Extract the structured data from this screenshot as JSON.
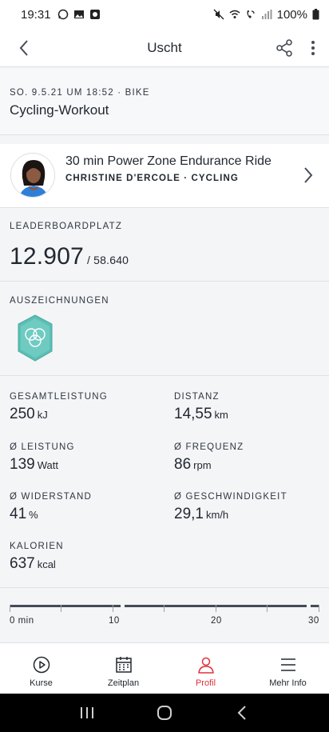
{
  "status_bar": {
    "time": "19:31",
    "battery": "100%"
  },
  "header": {
    "title": "Uscht"
  },
  "workout": {
    "meta": "SO. 9.5.21 UM 18:52 · BIKE",
    "name": "Cycling-Workout"
  },
  "class": {
    "title": "30 min Power Zone Endurance Ride",
    "subtitle": "CHRISTINE D'ERCOLE · CYCLING"
  },
  "leaderboard": {
    "label": "LEADERBOARDPLATZ",
    "rank": "12.907",
    "total": "/ 58.640"
  },
  "awards": {
    "label": "AUSZEICHNUNGEN",
    "badge_color": "#5bbfb5"
  },
  "stats": [
    {
      "label": "GESAMTLEISTUNG",
      "value": "250",
      "unit": "kJ"
    },
    {
      "label": "DISTANZ",
      "value": "14,55",
      "unit": "km"
    },
    {
      "label": "Ø LEISTUNG",
      "value": "139",
      "unit": "Watt"
    },
    {
      "label": "Ø FREQUENZ",
      "value": "86",
      "unit": "rpm"
    },
    {
      "label": "Ø WIDERSTAND",
      "value": "41",
      "unit": "%"
    },
    {
      "label": "Ø GESCHWINDIGKEIT",
      "value": "29,1",
      "unit": "km/h"
    },
    {
      "label": "KALORIEN",
      "value": "637",
      "unit": "kcal"
    }
  ],
  "timeline": {
    "labels": [
      "0 min",
      "10",
      "20",
      "30"
    ]
  },
  "tabs": [
    {
      "label": "Kurse",
      "icon": "play-circle-icon"
    },
    {
      "label": "Zeitplan",
      "icon": "calendar-icon"
    },
    {
      "label": "Profil",
      "icon": "person-icon",
      "active": true
    },
    {
      "label": "Mehr Info",
      "icon": "menu-icon"
    }
  ],
  "colors": {
    "accent": "#e0313b",
    "text": "#222831",
    "background": "#f4f5f7"
  }
}
